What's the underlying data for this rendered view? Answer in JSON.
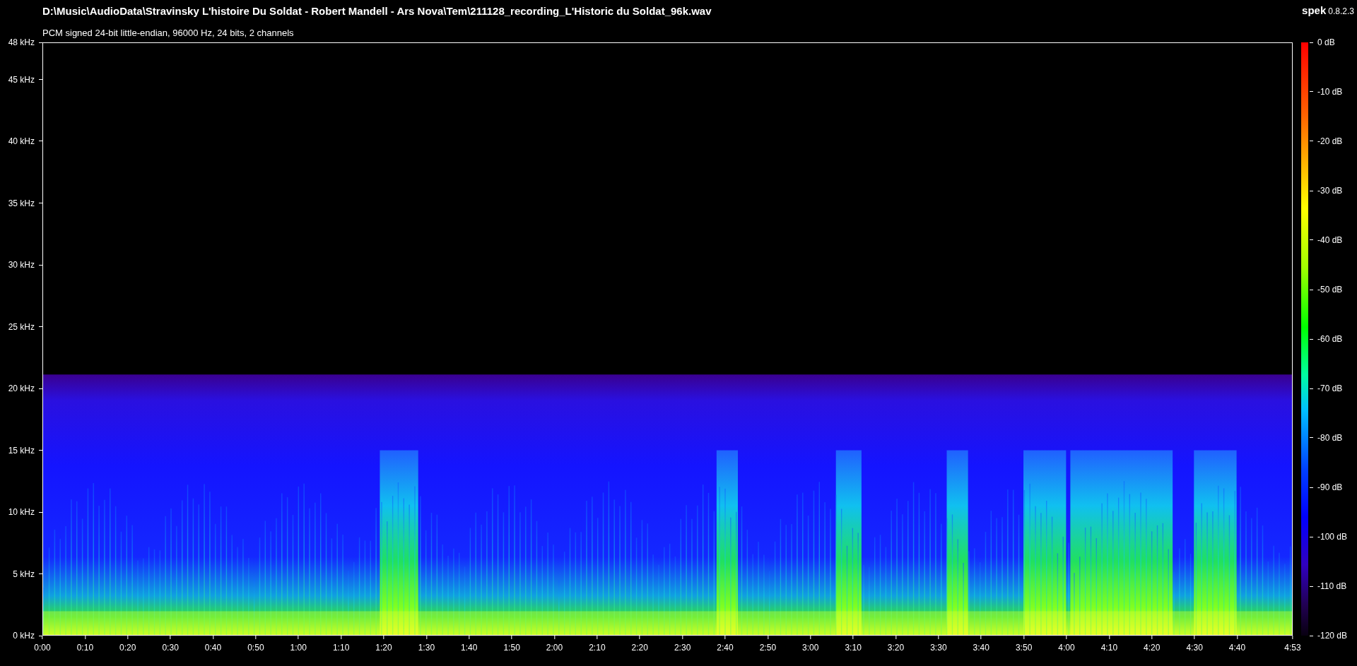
{
  "header": {
    "file_path": "D:\\Music\\AudioData\\Stravinsky L'histoire Du Soldat - Robert Mandell - Ars Nova\\Tem\\211128_recording_L'Historic du Soldat_96k.wav",
    "format_info": "PCM signed 24-bit little-endian, 96000 Hz, 24 bits, 2 channels",
    "app_name": "spek",
    "app_version": "0.8.2.3"
  },
  "frequency_axis": [
    "48 kHz",
    "45 kHz",
    "40 kHz",
    "35 kHz",
    "30 kHz",
    "25 kHz",
    "20 kHz",
    "15 kHz",
    "10 kHz",
    "5 kHz",
    "0 kHz"
  ],
  "time_axis": [
    "0:00",
    "0:10",
    "0:20",
    "0:30",
    "0:40",
    "0:50",
    "1:00",
    "1:10",
    "1:20",
    "1:30",
    "1:40",
    "1:50",
    "2:00",
    "2:10",
    "2:20",
    "2:30",
    "2:40",
    "2:50",
    "3:00",
    "3:10",
    "3:20",
    "3:30",
    "3:40",
    "3:50",
    "4:00",
    "4:10",
    "4:20",
    "4:30",
    "4:40",
    "4:53"
  ],
  "db_scale": [
    "0 dB",
    "-10 dB",
    "-20 dB",
    "-30 dB",
    "-40 dB",
    "-50 dB",
    "-60 dB",
    "-70 dB",
    "-80 dB",
    "-90 dB",
    "-100 dB",
    "-110 dB",
    "-120 dB"
  ]
}
